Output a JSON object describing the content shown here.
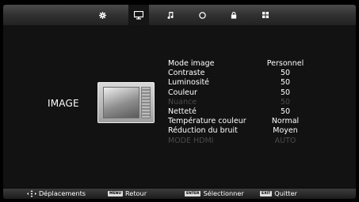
{
  "top_menu": [
    {
      "id": "settings",
      "icon": "gear-icon"
    },
    {
      "id": "picture",
      "icon": "monitor-icon",
      "active": true
    },
    {
      "id": "sound",
      "icon": "music-note-icon"
    },
    {
      "id": "timer",
      "icon": "clock-icon"
    },
    {
      "id": "lock",
      "icon": "lock-icon"
    },
    {
      "id": "setup",
      "icon": "grid-icon"
    }
  ],
  "section": {
    "title": "IMAGE",
    "illustration": "tv-illustration"
  },
  "menu_items": [
    {
      "label": "Mode image",
      "value": "Personnel",
      "enabled": true
    },
    {
      "label": "Contraste",
      "value": "50",
      "enabled": true
    },
    {
      "label": "Luminosité",
      "value": "50",
      "enabled": true
    },
    {
      "label": "Couleur",
      "value": "50",
      "enabled": true
    },
    {
      "label": "Nuance",
      "value": "50",
      "enabled": false
    },
    {
      "label": "Netteté",
      "value": "50",
      "enabled": true
    },
    {
      "label": "Température couleur",
      "value": "Normal",
      "enabled": true
    },
    {
      "label": "Réduction du bruit",
      "value": "Moyen",
      "enabled": true
    },
    {
      "label": "MODE HDMI",
      "value": "AUTO",
      "enabled": false
    }
  ],
  "footer": {
    "navigate": {
      "key_icon": "dpad-icon",
      "label": "Déplacements"
    },
    "back": {
      "key": "MENU",
      "label": "Retour"
    },
    "select": {
      "key": "ENTER",
      "label": "Sélectionner"
    },
    "exit": {
      "key": "EXIT",
      "label": "Quitter"
    }
  },
  "colors": {
    "background": "#121212",
    "disabled_text": "#4a4a4a",
    "text": "#ffffff"
  }
}
